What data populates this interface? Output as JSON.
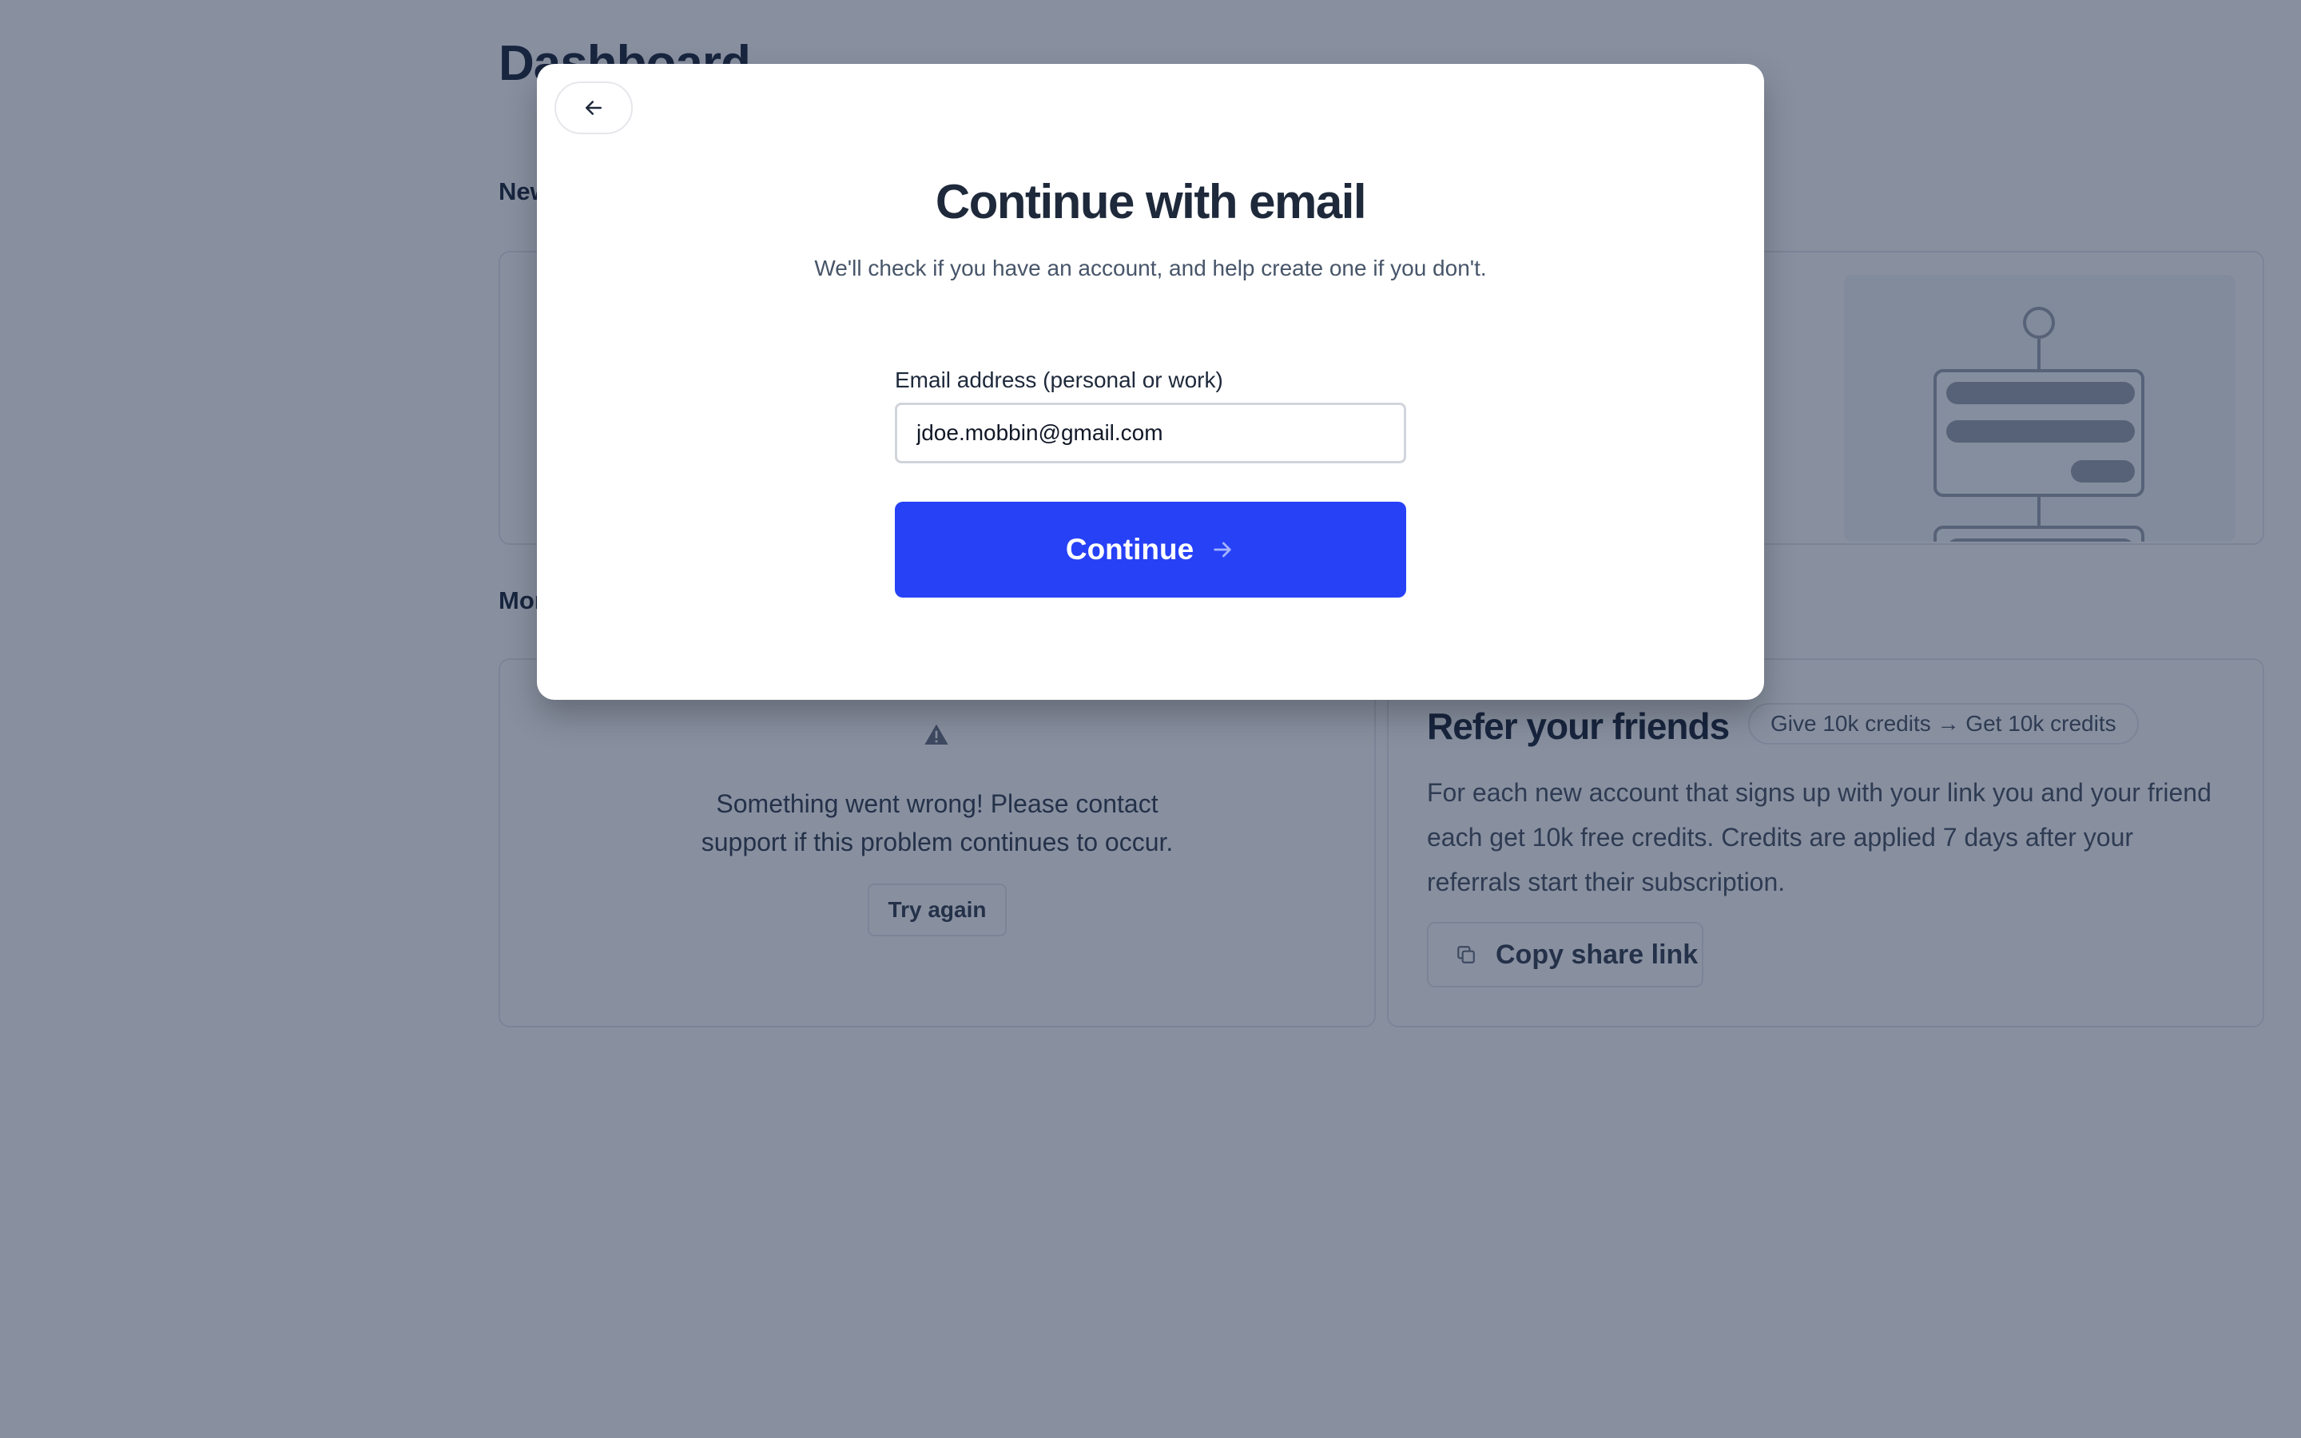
{
  "page": {
    "title": "Dashboard",
    "section_new": "New",
    "section_more": "More"
  },
  "error_card": {
    "icon": "warning-icon",
    "message_line1": "Something went wrong! Please contact",
    "message_line2": "support if this problem continues to occur.",
    "retry_label": "Try again"
  },
  "refer_card": {
    "title": "Refer your friends",
    "badge": "Give 10k credits → Get 10k credits",
    "description": "For each new account that signs up with your link you and your friend each get 10k free credits. Credits are applied 7 days after your referrals start their subscription.",
    "share_label": "Copy share link",
    "share_icon": "copy-icon"
  },
  "modal": {
    "back_icon": "arrow-left-icon",
    "title": "Continue with email",
    "subtitle": "We'll check if you have an account, and help create one if you don't.",
    "email_label": "Email address (personal or work)",
    "email_value": "jdoe.mobbin@gmail.com",
    "continue_label": "Continue",
    "continue_icon": "arrow-right-icon"
  },
  "colors": {
    "primary": "#2741f7",
    "overlay": "rgba(17,33,66,0.50)",
    "heading": "#1e293b"
  }
}
